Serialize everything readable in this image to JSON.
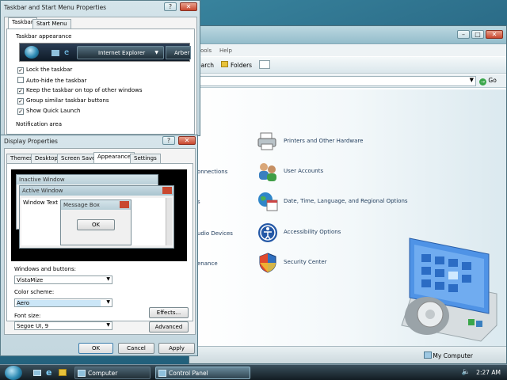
{
  "taskbar_props": {
    "title": "Taskbar and Start Menu Properties",
    "tabs": [
      "Taskbar",
      "Start Menu"
    ],
    "section_appearance": "Taskbar appearance",
    "preview_ie": "Internet Explorer",
    "preview_other": "Arber",
    "options": [
      {
        "label": "Lock the taskbar",
        "checked": true
      },
      {
        "label": "Auto-hide the taskbar",
        "checked": false
      },
      {
        "label": "Keep the taskbar on top of other windows",
        "checked": true
      },
      {
        "label": "Group similar taskbar buttons",
        "checked": true
      },
      {
        "label": "Show Quick Launch",
        "checked": true
      }
    ],
    "section_notification": "Notification area"
  },
  "display_props": {
    "title": "Display Properties",
    "tabs": [
      "Themes",
      "Desktop",
      "Screen Saver",
      "Appearance",
      "Settings"
    ],
    "preview": {
      "inactive_window": "Inactive Window",
      "active_window": "Active Window",
      "window_text": "Window Text",
      "message_box": "Message Box",
      "ok": "OK"
    },
    "windows_buttons_label": "Windows and buttons:",
    "windows_buttons_value": "VistaMize",
    "color_scheme_label": "Color scheme:",
    "color_scheme_value": "Aero",
    "font_size_label": "Font size:",
    "font_size_value": "Segoe UI, 9",
    "effects_button": "Effects...",
    "advanced_button": "Advanced",
    "ok_button": "OK",
    "cancel_button": "Cancel",
    "apply_button": "Apply"
  },
  "control_panel": {
    "menu_partial": "ools",
    "menu_help": "Help",
    "search_partial": "earch",
    "folders_button": "Folders",
    "go_button": "Go",
    "categories": [
      {
        "label": "Printers and Other Hardware",
        "icon": "printer-icon"
      },
      {
        "label": "User Accounts",
        "icon": "users-icon"
      },
      {
        "label": "Date, Time, Language, and Regional Options",
        "icon": "globe-calendar-icon"
      },
      {
        "label": "Accessibility Options",
        "icon": "accessibility-icon"
      },
      {
        "label": "Security Center",
        "icon": "shield-icon"
      }
    ],
    "left_partial_labels": [
      "onnections",
      "s",
      "udio Devices",
      "enance"
    ],
    "status_location": "My Computer"
  },
  "taskbar": {
    "tasks": [
      "Computer",
      "Control Panel"
    ],
    "clock": "2:27 AM"
  },
  "colors": {
    "accent_blue": "#2d8ab3",
    "selected_field": "#cbe6f7",
    "close_red": "#c9482f"
  }
}
